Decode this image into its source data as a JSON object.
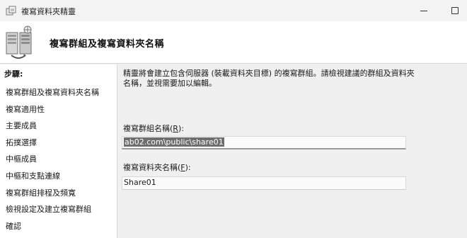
{
  "window": {
    "title": "複寫資料夾精靈"
  },
  "header": {
    "heading": "複寫群組及複寫資料夾名稱"
  },
  "steps": {
    "title": "步驟:",
    "items": [
      {
        "label": "複寫群組及複寫資料夾名稱"
      },
      {
        "label": "複寫適用性"
      },
      {
        "label": "主要成員"
      },
      {
        "label": "拓撲選擇"
      },
      {
        "label": "中樞成員"
      },
      {
        "label": "中樞和支點連線"
      },
      {
        "label": "複寫群組排程及頻寬"
      },
      {
        "label": "檢視設定及建立複寫群組"
      },
      {
        "label": "確認"
      }
    ]
  },
  "main": {
    "description": "精靈將會建立包含伺服器 (裝載資料夾目標) 的複寫群組。請檢視建議的群組及資料夾名稱，並視需要加以編輯。",
    "group_name_label": "複寫群組名稱",
    "group_name_hotkey": "R",
    "group_name_value": "ab02.com\\public\\share01",
    "folder_name_label": "複寫資料夾名稱",
    "folder_name_hotkey": "F",
    "folder_name_value": "Share01"
  },
  "icons": {
    "app": "replication-wizard-icon",
    "header": "server-replication-icon"
  }
}
